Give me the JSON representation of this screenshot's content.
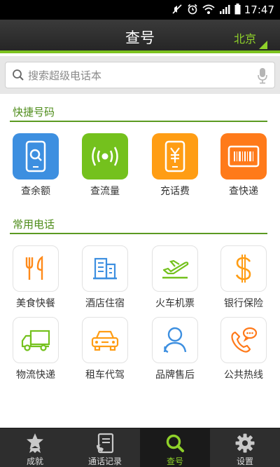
{
  "status_bar": {
    "time": "17:47"
  },
  "header": {
    "title": "查号",
    "city": "北京"
  },
  "search": {
    "placeholder": "搜索超级电话本"
  },
  "quick_section": {
    "title": "快捷号码",
    "items": [
      {
        "label": "查余额",
        "icon": "phone-search-icon",
        "color": "#3d8fe0"
      },
      {
        "label": "查流量",
        "icon": "signal-icon",
        "color": "#74c11d"
      },
      {
        "label": "充话费",
        "icon": "phone-yuan-icon",
        "color": "#ff9d14"
      },
      {
        "label": "查快递",
        "icon": "barcode-icon",
        "color": "#ff7a1a"
      }
    ]
  },
  "common_section": {
    "title": "常用电话",
    "items": [
      {
        "label": "美食快餐",
        "icon": "fork-knife-icon",
        "color": "#ff8a1a"
      },
      {
        "label": "酒店住宿",
        "icon": "hotel-icon",
        "color": "#3d8fe0"
      },
      {
        "label": "火车机票",
        "icon": "plane-icon",
        "color": "#74c11d"
      },
      {
        "label": "银行保险",
        "icon": "dollar-icon",
        "color": "#ff9d14"
      },
      {
        "label": "物流快递",
        "icon": "truck-icon",
        "color": "#74c11d"
      },
      {
        "label": "租车代驾",
        "icon": "car-icon",
        "color": "#ff9d14"
      },
      {
        "label": "品牌售后",
        "icon": "support-person-icon",
        "color": "#3d8fe0"
      },
      {
        "label": "公共热线",
        "icon": "hotline-icon",
        "color": "#ff7a1a"
      }
    ]
  },
  "tabs": [
    {
      "label": "成就",
      "icon": "star-medal-icon",
      "active": false
    },
    {
      "label": "通话记录",
      "icon": "call-log-icon",
      "active": false
    },
    {
      "label": "查号",
      "icon": "search-icon",
      "active": true
    },
    {
      "label": "设置",
      "icon": "gear-icon",
      "active": false
    }
  ],
  "colors": {
    "accent": "#7cc21f",
    "section_title": "#4e8c1a",
    "header_bg": "#2f2f2f"
  }
}
